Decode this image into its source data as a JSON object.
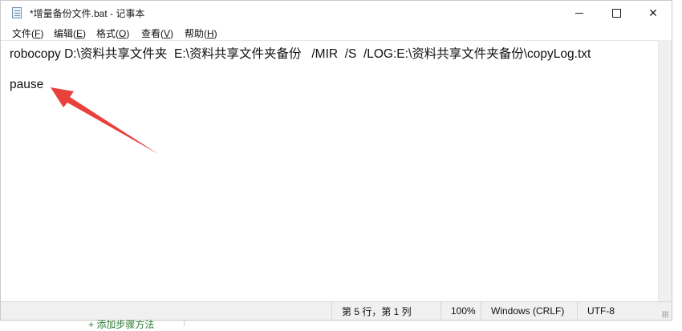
{
  "window": {
    "title": "*增量备份文件.bat - 记事本",
    "icon": "notepad-icon",
    "controls": {
      "minimize_icon": "minimize-icon",
      "maximize_icon": "maximize-icon",
      "close_label": "✕"
    }
  },
  "menu": {
    "items": [
      {
        "label": "文件(",
        "key": "F",
        "suffix": ")"
      },
      {
        "label": "编辑(",
        "key": "E",
        "suffix": ")"
      },
      {
        "label": "格式(",
        "key": "O",
        "suffix": ")"
      },
      {
        "label": "查看(",
        "key": "V",
        "suffix": ")"
      },
      {
        "label": "帮助(",
        "key": "H",
        "suffix": ")"
      }
    ]
  },
  "editor": {
    "lines": [
      "robocopy D:\\资料共享文件夹  E:\\资料共享文件夹备份   /MIR  /S  /LOG:E:\\资料共享文件夹备份\\copyLog.txt",
      "pause"
    ]
  },
  "annotation": {
    "arrow_color": "#e8413c",
    "icon": "red-arrow-annotation"
  },
  "status": {
    "position": "第 5 行，第 1 列",
    "zoom": "100%",
    "line_ending": "Windows (CRLF)",
    "encoding": "UTF-8"
  },
  "background_page": {
    "partial_text": "+ 添加步骤方法"
  }
}
